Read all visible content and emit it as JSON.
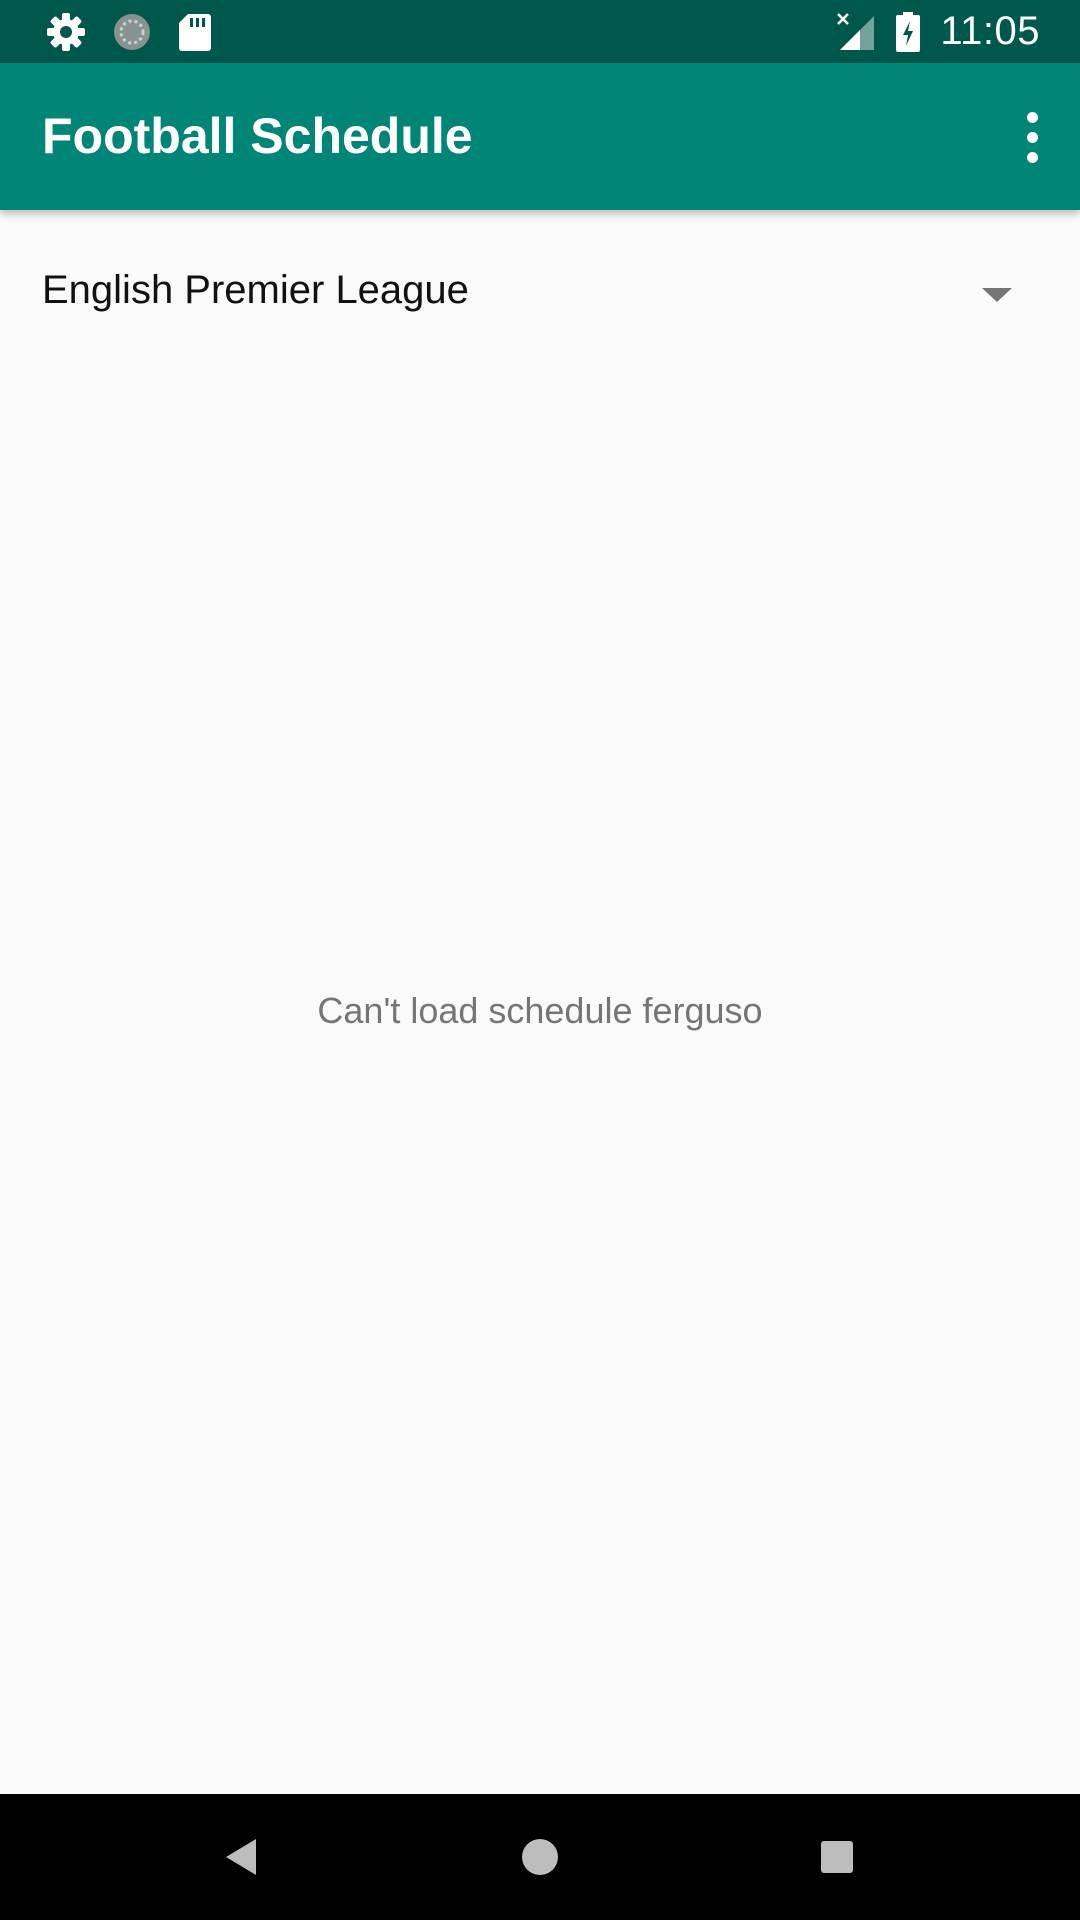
{
  "status_bar": {
    "time": "11:05",
    "left_icons": [
      "gear-icon",
      "sync-icon",
      "sd-card-icon"
    ],
    "right_icons": [
      "signal-off-icon",
      "battery-charging-icon"
    ]
  },
  "app_bar": {
    "title": "Football Schedule",
    "overflow_icon": "more-vert-icon"
  },
  "spinner": {
    "selected": "English Premier League",
    "arrow_icon": "dropdown-arrow-icon"
  },
  "empty_state": {
    "message": "Can't load schedule ferguso"
  },
  "nav_bar": {
    "buttons": [
      "back-icon",
      "home-icon",
      "recents-icon"
    ]
  },
  "colors": {
    "status_bar": "#00574b",
    "primary": "#008577",
    "background": "#fafafa",
    "secondary_text": "#757575"
  }
}
